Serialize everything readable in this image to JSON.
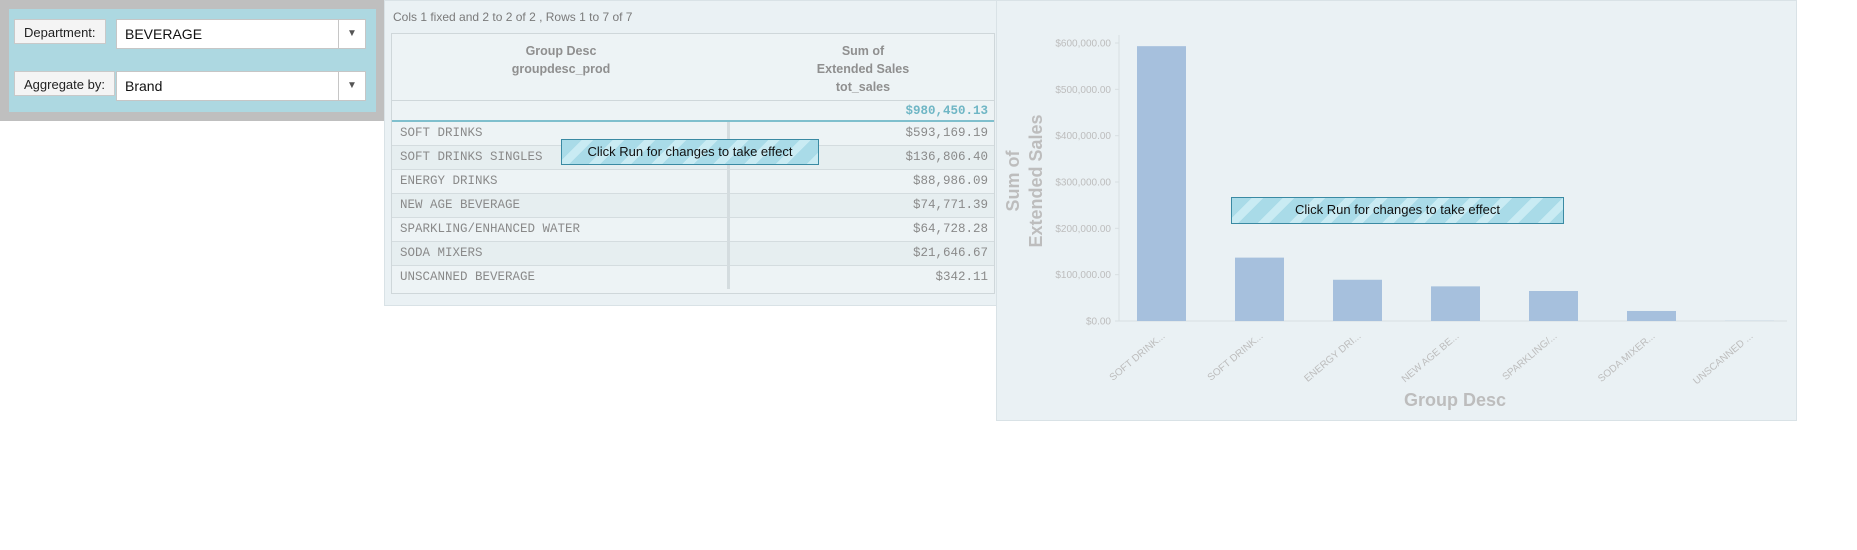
{
  "filters": {
    "department": {
      "label": "Department:",
      "value": "BEVERAGE"
    },
    "aggregate": {
      "label": "Aggregate by:",
      "value": "Brand"
    }
  },
  "table": {
    "info": "Cols 1 fixed and 2 to 2 of 2 , Rows 1 to 7 of 7",
    "headers": {
      "col1": [
        "Group Desc",
        "groupdesc_prod"
      ],
      "col2": [
        "Sum of",
        "Extended Sales",
        "tot_sales"
      ]
    },
    "total": "$980,450.13",
    "rows": [
      {
        "group": "SOFT DRINKS",
        "sales": "$593,169.19"
      },
      {
        "group": "SOFT DRINKS SINGLES",
        "sales": "$136,806.40"
      },
      {
        "group": "ENERGY DRINKS",
        "sales": "$88,986.09"
      },
      {
        "group": "NEW AGE BEVERAGE",
        "sales": "$74,771.39"
      },
      {
        "group": "SPARKLING/ENHANCED WATER",
        "sales": "$64,728.28"
      },
      {
        "group": "SODA MIXERS",
        "sales": "$21,646.67"
      },
      {
        "group": "UNSCANNED BEVERAGE",
        "sales": "$342.11"
      }
    ],
    "run_banner": "Click Run for changes to take effect"
  },
  "chart": {
    "run_banner": "Click Run for changes to take effect"
  },
  "colors": {
    "bar": "#a6c0dd",
    "accent": "#6fb6c5",
    "panel": "#eaf1f4",
    "filter_bg": "#add8e1"
  },
  "chart_data": {
    "type": "bar",
    "categories": [
      "SOFT DRINK...",
      "SOFT DRINK...",
      "ENERGY DRI...",
      "NEW AGE BE...",
      "SPARKLING/...",
      "SODA MIXER...",
      "UNSCANNED ..."
    ],
    "values": [
      593169.19,
      136806.4,
      88986.09,
      74771.39,
      64728.28,
      21646.67,
      342.11
    ],
    "xlabel": "Group Desc",
    "ylabel": [
      "Sum of",
      "Extended Sales"
    ],
    "ylim": [
      0,
      600000
    ],
    "yticks": [
      0,
      100000,
      200000,
      300000,
      400000,
      500000,
      600000
    ],
    "ytick_labels": [
      "$0.00",
      "$100,000.00",
      "$200,000.00",
      "$300,000.00",
      "$400,000.00",
      "$500,000.00",
      "$600,000.00"
    ],
    "grid": false,
    "legend": "none"
  }
}
